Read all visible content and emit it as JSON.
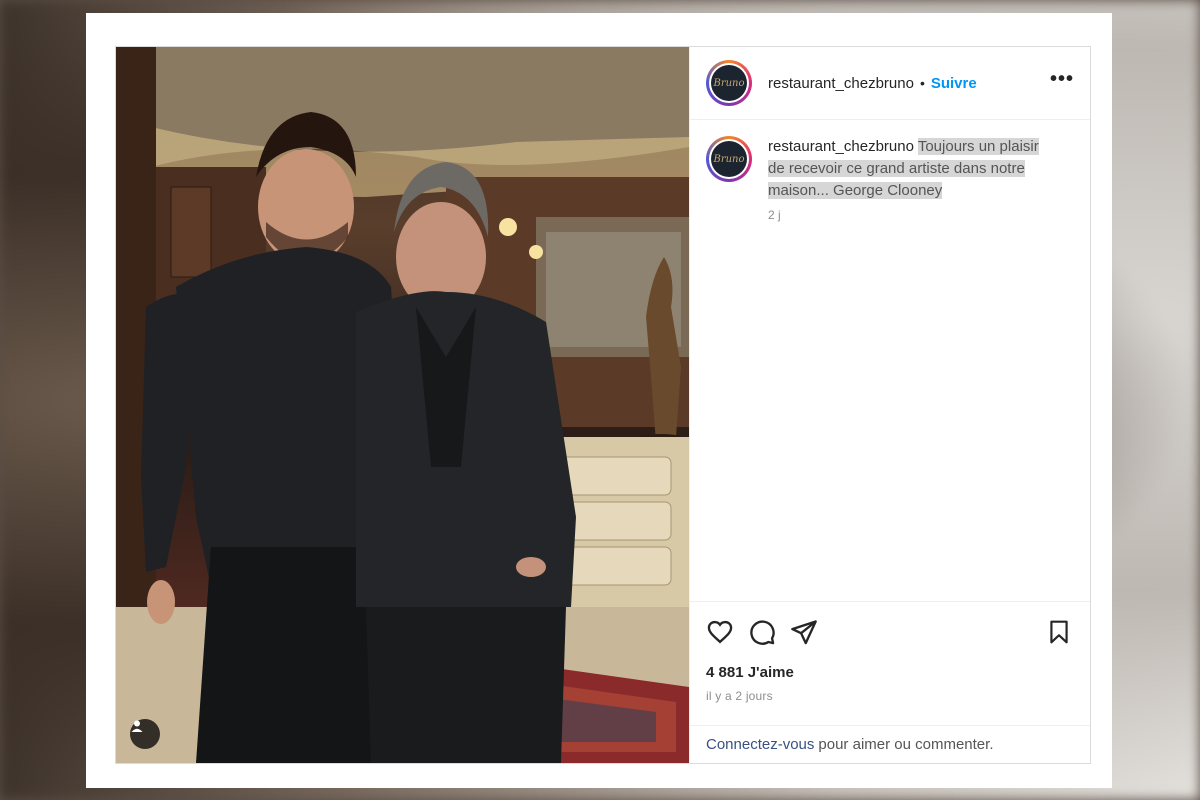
{
  "post": {
    "username": "restaurant_chezbruno",
    "separator": "•",
    "follow_label": "Suivre",
    "more_label": "•••",
    "avatar_text": "Bruno",
    "caption": {
      "username": "restaurant_chezbruno",
      "text": "Toujours un plaisir de recevoir ce grand artiste dans notre maison... George Clooney",
      "time": "2 j"
    },
    "likes": "4 881 J'aime",
    "posted_ago": "il y a 2 jours",
    "login": {
      "link": "Connectez-vous",
      "text": "pour aimer ou commenter."
    }
  },
  "icons": [
    "user-tag-icon",
    "heart-icon",
    "comment-icon",
    "share-icon",
    "bookmark-icon",
    "more-icon"
  ],
  "colors": {
    "accent": "#0095f6",
    "link": "#385185",
    "text": "#262626",
    "muted": "#8e8e8e"
  }
}
